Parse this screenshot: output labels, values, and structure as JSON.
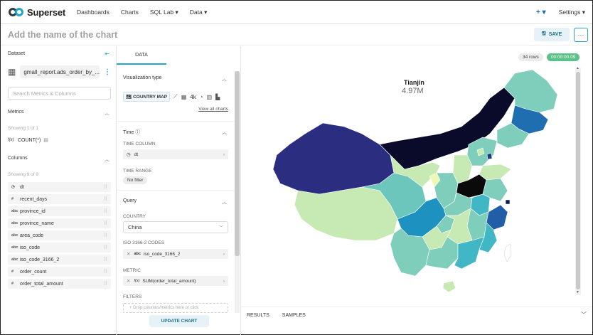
{
  "nav": {
    "brand": "Superset",
    "links": [
      "Dashboards",
      "Charts",
      "SQL Lab ▾",
      "Data ▾"
    ],
    "plus": "+ ▾",
    "settings": "Settings ▾"
  },
  "header": {
    "title": "Add the name of the chart",
    "save_label": "SAVE",
    "more_label": "···"
  },
  "left": {
    "dataset_label": "Dataset",
    "dataset_name": "gmall_report.ads_order_by_...",
    "search_placeholder": "Search Metrics & Columns",
    "metrics_label": "Metrics",
    "metrics_count": "Showing 1 of 1",
    "metric_item": {
      "type": "f(x)",
      "label": "COUNT(*)"
    },
    "columns_label": "Columns",
    "columns_count": "Showing 9 of 9",
    "columns": [
      {
        "type": "◷",
        "label": "dt"
      },
      {
        "type": "#",
        "label": "recent_days"
      },
      {
        "type": "abc",
        "label": "province_id"
      },
      {
        "type": "abc",
        "label": "province_name"
      },
      {
        "type": "abc",
        "label": "area_code"
      },
      {
        "type": "abc",
        "label": "iso_code"
      },
      {
        "type": "abc",
        "label": "iso_code_3166_2"
      },
      {
        "type": "#",
        "label": "order_count"
      },
      {
        "type": "#",
        "label": "order_total_amount"
      }
    ]
  },
  "mid": {
    "tab": "DATA",
    "viz_type_label": "Visualization type",
    "viz_selected": "COUNTRY MAP",
    "viz_4k": "4k",
    "view_all": "View all charts",
    "time_label": "Time ⓘ",
    "time_column_label": "TIME COLUMN",
    "time_column_value": "dt",
    "time_range_label": "TIME RANGE",
    "time_range_value": "No filter",
    "query_label": "Query",
    "country_label": "COUNTRY",
    "country_value": "China",
    "iso_label": "ISO 3166-2 CODES",
    "iso_value": "iso_code_3166_2",
    "metric_label": "METRIC",
    "metric_value": "SUM(order_total_amount)",
    "filters_label": "FILTERS",
    "filters_placeholder": "+ Drop columns/metrics here or click",
    "update_button": "UPDATE CHART"
  },
  "chart": {
    "rows": "34 rows",
    "time": "00:00:00.09",
    "tooltip_name": "Tianjin",
    "tooltip_value": "4.97M",
    "bottom_tabs": [
      "RESULTS",
      "SAMPLES"
    ]
  },
  "colors": {
    "accent": "#20a7c9",
    "success": "#5ac189",
    "map_scale": [
      "#ffffd9",
      "#edf8b1",
      "#c7e9b4",
      "#7fcdbb",
      "#41b6c4",
      "#1d91c0",
      "#225ea8",
      "#253494",
      "#081d58",
      "#0a0a23"
    ]
  }
}
